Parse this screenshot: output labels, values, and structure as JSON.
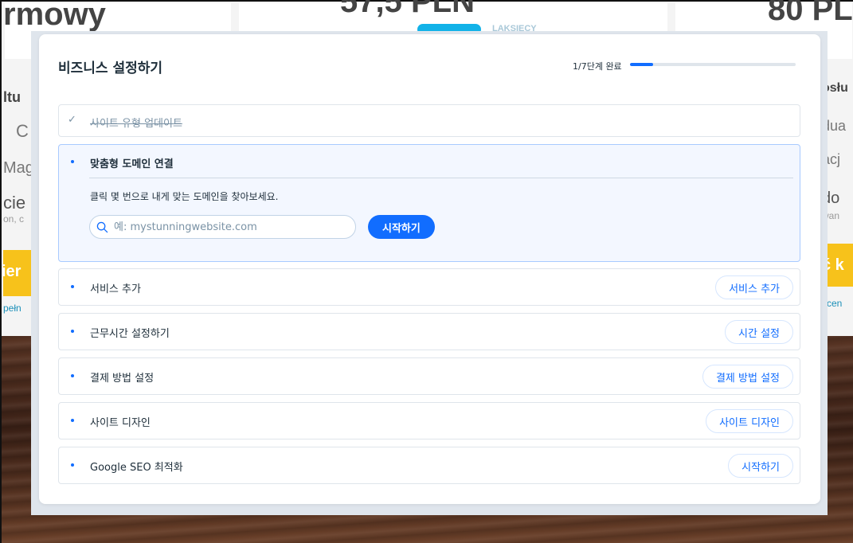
{
  "background": {
    "fragments": [
      "rmowy",
      "57,5 PLN",
      "80 PL",
      "ltu",
      "C",
      "Mag",
      "cie",
      "on, c",
      "ier",
      "pełn",
      "osłu",
      "dua",
      "acj",
      "do",
      "wan",
      "ć k",
      "cen",
      "LAKSIECY"
    ]
  },
  "modal": {
    "title": "비즈니스 설정하기",
    "progress": {
      "label": "1/7단계 완료",
      "fraction": 0.14
    }
  },
  "steps": [
    {
      "label": "사이트 유형 업데이트",
      "status": "done",
      "icon": "checkmark-icon"
    },
    {
      "label": "맞춤형 도메인 연결",
      "status": "expanded",
      "description": "클릭 몇 번으로 내게 맞는 도메인을 찾아보세요.",
      "search_placeholder": "예: mystunningwebsite.com",
      "search_icon": "search-icon",
      "button": "시작하기"
    },
    {
      "label": "서비스 추가",
      "status": "todo",
      "button": "서비스 추가"
    },
    {
      "label": "근무시간 설정하기",
      "status": "todo",
      "button": "시간 설정"
    },
    {
      "label": "결제 방법 설정",
      "status": "todo",
      "button": "결제 방법 설정"
    },
    {
      "label": "사이트 디자인",
      "status": "todo",
      "button": "사이트 디자인"
    },
    {
      "label": "Google SEO 최적화",
      "status": "todo",
      "button": "시작하기"
    }
  ],
  "colors": {
    "accent": "#116dff",
    "text": "#20303c",
    "muted": "#7a92a5",
    "border": "#dfe5eb",
    "expanded_bg": "#f3f7ff"
  }
}
